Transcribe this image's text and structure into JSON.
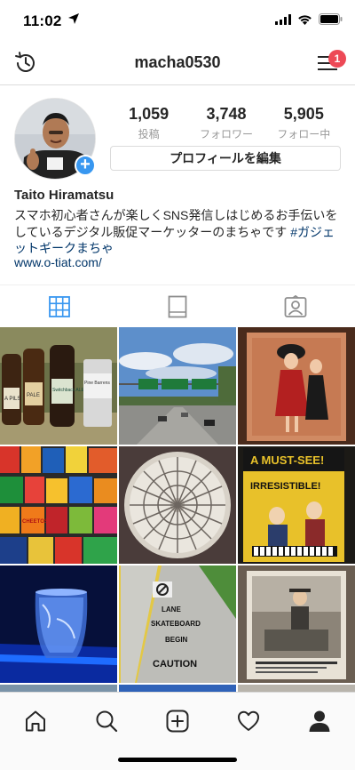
{
  "status_bar": {
    "time": "11:02",
    "icons": [
      "location-arrow-icon",
      "signal-icon",
      "wifi-icon",
      "battery-icon"
    ]
  },
  "header": {
    "username": "macha0530",
    "left_icon": "history-icon",
    "right_icon": "menu-icon",
    "notification_count": "1"
  },
  "profile": {
    "stats": [
      {
        "value": "1,059",
        "label": "投稿"
      },
      {
        "value": "3,748",
        "label": "フォロワー"
      },
      {
        "value": "5,905",
        "label": "フォロー中"
      }
    ],
    "edit_button": "プロフィールを編集",
    "name": "Taito Hiramatsu",
    "bio_text": "スマホ初心者さんが楽しくSNS発信しはじめるお手伝いをしているデジタル販促マーケッターのまちゃです ",
    "bio_hashtag": "#ガジェットギークまちゃ",
    "website": "www.o-tiat.com/"
  },
  "tabs": [
    {
      "icon": "grid-icon",
      "active": true
    },
    {
      "icon": "feed-icon",
      "active": false
    },
    {
      "icon": "tagged-icon",
      "active": false
    }
  ],
  "posts": [
    {
      "description": "beer bottles",
      "labels": [
        "A PILS",
        "PALE",
        "Switchback ALE",
        "Pine Barrens"
      ]
    },
    {
      "description": "highway with green signs",
      "labels": []
    },
    {
      "description": "vintage illustration poster",
      "labels": []
    },
    {
      "description": "snack vending machine",
      "labels": [
        "CHEETOS"
      ]
    },
    {
      "description": "glass dome skylight",
      "labels": []
    },
    {
      "description": "musical poster",
      "labels": [
        "A MUST-SEE!",
        "IRRESISTIBLE!"
      ]
    },
    {
      "description": "glass with blue light",
      "labels": []
    },
    {
      "description": "skateboard lane pavement",
      "labels": [
        "LANE",
        "SKATEBOARD",
        "BEGIN",
        "CAUTION"
      ]
    },
    {
      "description": "framed photograph",
      "labels": []
    }
  ],
  "bottom_nav": [
    {
      "icon": "home-icon"
    },
    {
      "icon": "search-icon"
    },
    {
      "icon": "add-post-icon"
    },
    {
      "icon": "activity-heart-icon"
    },
    {
      "icon": "profile-icon"
    }
  ],
  "colors": {
    "accent": "#3897f0",
    "badge": "#ed4956",
    "link": "#003569",
    "tab_active": "#3897f0",
    "tab_inactive": "#8e8e8e"
  }
}
